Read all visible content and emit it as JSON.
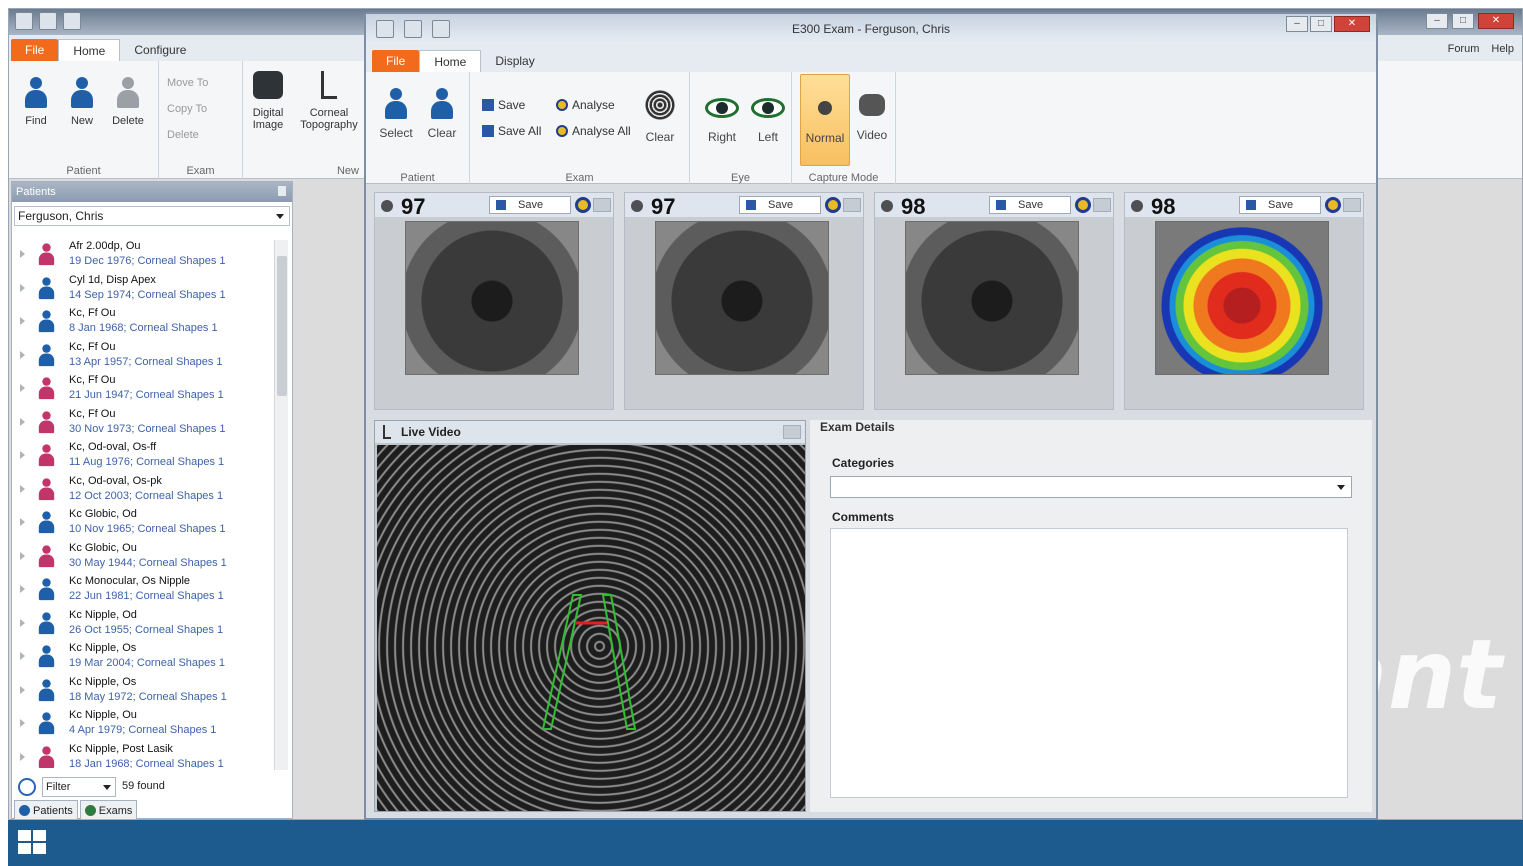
{
  "background_app": {
    "tabs": [
      "File",
      "Home",
      "Configure"
    ],
    "active_tab": "Home",
    "ribbon": {
      "patient_group_label": "Patient",
      "exam_group_label": "Exam",
      "new_group_label": "New",
      "find_label": "Find",
      "new_label": "New",
      "delete_label": "Delete",
      "move_to_label": "Move To",
      "copy_to_label": "Copy To",
      "exam_delete_label": "Delete",
      "digital_image_label": "Digital Image",
      "corneal_topography_label": "Corneal Topography"
    },
    "right_links": [
      "Forum",
      "Help"
    ],
    "watermark": "ant"
  },
  "patients_panel": {
    "header": "Patients",
    "selected_patient": "Ferguson, Chris",
    "exams": [
      {
        "name": "Afr 2.00dp, Ou",
        "detail": "19 Dec 1976; Corneal Shapes 1",
        "color": "pink"
      },
      {
        "name": "Cyl 1d, Disp Apex",
        "detail": "14 Sep 1974; Corneal Shapes 1",
        "color": "blue"
      },
      {
        "name": "Kc, Ff Ou",
        "detail": "8 Jan 1968; Corneal Shapes 1",
        "color": "blue"
      },
      {
        "name": "Kc, Ff Ou",
        "detail": "13 Apr 1957; Corneal Shapes 1",
        "color": "blue"
      },
      {
        "name": "Kc, Ff Ou",
        "detail": "21 Jun 1947; Corneal Shapes 1",
        "color": "pink"
      },
      {
        "name": "Kc, Ff Ou",
        "detail": "30 Nov 1973; Corneal Shapes 1",
        "color": "pink"
      },
      {
        "name": "Kc, Od-oval, Os-ff",
        "detail": "11 Aug 1976; Corneal Shapes 1",
        "color": "pink"
      },
      {
        "name": "Kc, Od-oval, Os-pk",
        "detail": "12 Oct 2003; Corneal Shapes 1",
        "color": "pink"
      },
      {
        "name": "Kc Globic, Od",
        "detail": "10 Nov 1965; Corneal Shapes 1",
        "color": "blue"
      },
      {
        "name": "Kc Globic, Ou",
        "detail": "30 May 1944; Corneal Shapes 1",
        "color": "pink"
      },
      {
        "name": "Kc Monocular, Os Nipple",
        "detail": "22 Jun 1981; Corneal Shapes 1",
        "color": "blue"
      },
      {
        "name": "Kc Nipple, Od",
        "detail": "26 Oct 1955; Corneal Shapes 1",
        "color": "blue"
      },
      {
        "name": "Kc Nipple, Os",
        "detail": "19 Mar 2004; Corneal Shapes 1",
        "color": "blue"
      },
      {
        "name": "Kc Nipple, Os",
        "detail": "18 May 1972; Corneal Shapes 1",
        "color": "blue"
      },
      {
        "name": "Kc Nipple, Ou",
        "detail": "4 Apr 1979; Corneal Shapes 1",
        "color": "blue"
      },
      {
        "name": "Kc Nipple, Post Lasik",
        "detail": "18 Jan 1968; Corneal Shapes 1",
        "color": "pink"
      }
    ],
    "filter_label": "Filter",
    "found_count": "59 found",
    "bottom_tabs": [
      "Patients",
      "Exams"
    ]
  },
  "exam_window": {
    "title": "E300 Exam - Ferguson, Chris",
    "tabs": [
      "File",
      "Home",
      "Display"
    ],
    "active_tab": "Home",
    "ribbon": {
      "patient_group": "Patient",
      "exam_group": "Exam",
      "eye_group": "Eye",
      "capture_mode_group": "Capture Mode",
      "select": "Select",
      "clear": "Clear",
      "save": "Save",
      "save_all": "Save All",
      "analyse": "Analyse",
      "analyse_all": "Analyse All",
      "exam_clear": "Clear",
      "right": "Right",
      "left": "Left",
      "normal": "Normal",
      "video": "Video"
    },
    "captures": [
      {
        "score": "97",
        "save_label": "Save",
        "type": "eye"
      },
      {
        "score": "97",
        "save_label": "Save",
        "type": "eye"
      },
      {
        "score": "98",
        "save_label": "Save",
        "type": "eye"
      },
      {
        "score": "98",
        "save_label": "Save",
        "type": "topography"
      }
    ],
    "live_video_label": "Live Video",
    "exam_details": {
      "title": "Exam Details",
      "categories_label": "Categories",
      "categories_value": "",
      "comments_label": "Comments",
      "comments_value": ""
    }
  },
  "colors": {
    "file_tab": "#f26b1d",
    "title_bar": "#c7d3e1",
    "taskbar": "#1d5b8f",
    "person_blue": "#1f5fa8",
    "person_pink": "#c2356b"
  }
}
